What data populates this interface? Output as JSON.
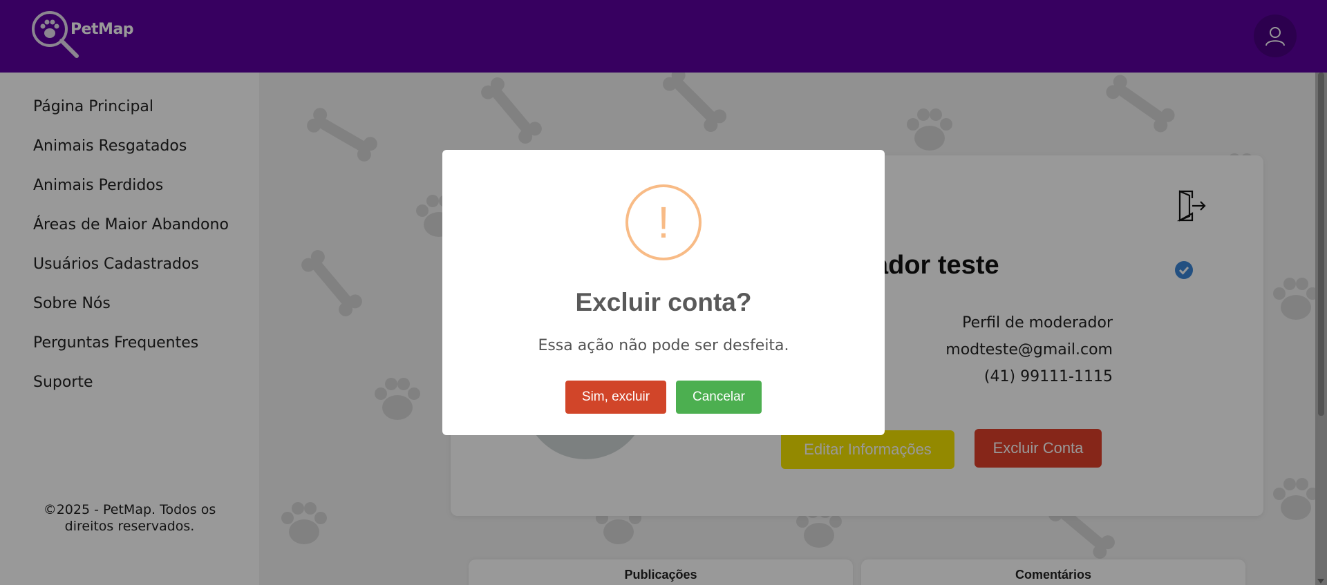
{
  "app": {
    "name": "PetMap"
  },
  "colors": {
    "header": "#5d00a0",
    "overlay": "rgba(0,0,0,0.4)",
    "confirm": "#d14529",
    "cancel": "#4caf50",
    "warning": "#f8bb86",
    "edit": "#f5e400",
    "delete": "#e0402a"
  },
  "header": {
    "logo_icon": "paw-magnifier-icon",
    "user_icon": "user-icon"
  },
  "sidebar": {
    "items": [
      {
        "label": "Página Principal"
      },
      {
        "label": "Animais Resgatados"
      },
      {
        "label": "Animais Perdidos"
      },
      {
        "label": "Áreas de Maior Abandono"
      },
      {
        "label": "Usuários Cadastrados"
      },
      {
        "label": "Sobre Nós"
      },
      {
        "label": "Perguntas Frequentes"
      },
      {
        "label": "Suporte"
      }
    ],
    "footer": "©2025 - PetMap. Todos os direitos reservados."
  },
  "profile": {
    "name_visible": "ador teste",
    "colon": ":",
    "role": "Perfil de moderador",
    "email": "modteste@gmail.com",
    "phone": "(41) 99111-1115",
    "edit_label": "Editar Informações",
    "delete_label": "Excluir Conta"
  },
  "bottom_tabs": {
    "posts": "Publicações",
    "comments": "Comentários"
  },
  "dialog": {
    "icon": "!",
    "title": "Excluir conta?",
    "text": "Essa ação não pode ser desfeita.",
    "confirm_label": "Sim, excluir",
    "cancel_label": "Cancelar"
  }
}
